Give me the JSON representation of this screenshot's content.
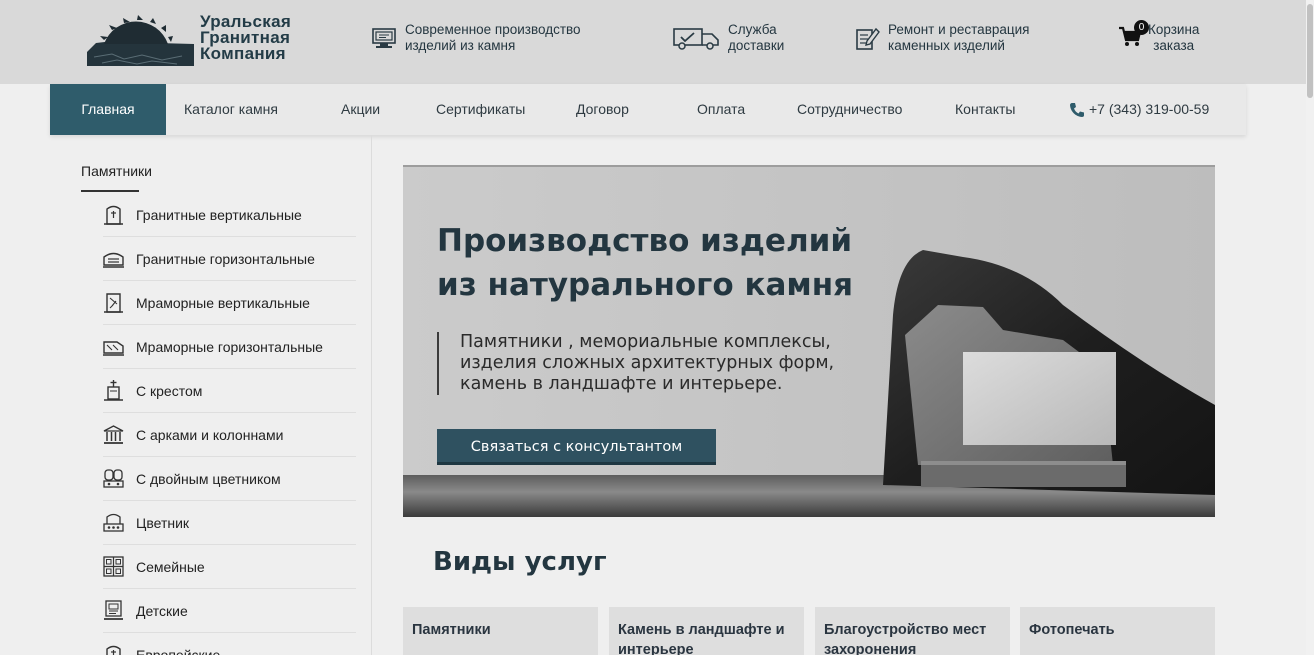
{
  "header": {
    "logo_lines": [
      "Уральская",
      "Гранитная",
      "Компания"
    ],
    "features": [
      {
        "icon": "production-icon",
        "lines": [
          "Современное производство",
          "изделий из камня"
        ]
      },
      {
        "icon": "delivery-truck-icon",
        "lines": [
          "Служба",
          "доставки"
        ]
      },
      {
        "icon": "restoration-icon",
        "lines": [
          "Ремонт и реставрация",
          "каменных изделий"
        ]
      }
    ],
    "cart": {
      "count": "0",
      "lines": [
        "Корзина",
        "заказа"
      ]
    }
  },
  "nav": {
    "items": [
      "Главная",
      "Каталог камня",
      "Акции",
      "Сертификаты",
      "Договор",
      "Оплата",
      "Сотрудничество",
      "Контакты"
    ],
    "phone": "+7 (343) 319-00-59"
  },
  "sidebar": {
    "heading": "Памятники",
    "items": [
      "Гранитные вертикальные",
      "Гранитные горизонтальные",
      "Мраморные вертикальные",
      "Мраморные горизонтальные",
      "С крестом",
      "С арками и колоннами",
      "С двойным цветником",
      "Цветник",
      "Семейные",
      "Детские",
      "Европейские"
    ]
  },
  "hero": {
    "title_lines": [
      "Производство изделий",
      "из натурального камня"
    ],
    "subtitle_lines": [
      "Памятники , мемориальные комплексы,",
      "изделия сложных архитектурных форм,",
      "камень в ландшафте и интерьере."
    ],
    "button": "Связаться с консультантом"
  },
  "services": {
    "title": "Виды услуг",
    "cards": [
      "Памятники",
      "Камень в ландшафте и интерьере",
      "Благоустройство мест захоронения",
      "Фотопечать"
    ]
  }
}
